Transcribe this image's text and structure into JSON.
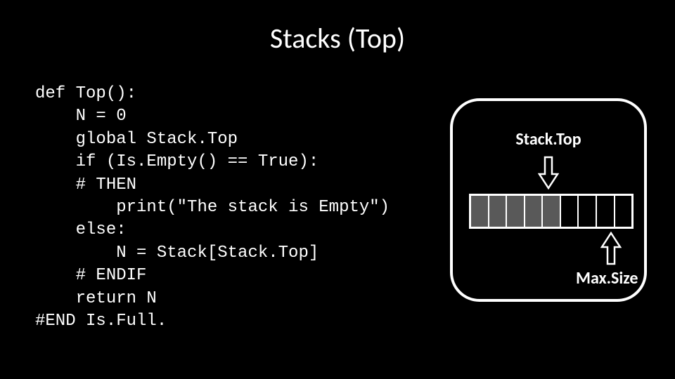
{
  "slide": {
    "title": "Stacks (Top)"
  },
  "code": {
    "line1": "def Top():",
    "line2": "    N = 0",
    "line3": "    global Stack.Top",
    "line4": "    if (Is.Empty() == True):",
    "line5": "    # THEN",
    "line6": "        print(\"The stack is Empty\")",
    "line7": "    else:",
    "line8": "        N = Stack[Stack.Top]",
    "line9": "    # ENDIF",
    "line10": "    return N",
    "line11": "#END Is.Full."
  },
  "diagram": {
    "stack_top_label": "Stack.Top",
    "max_size_label": "Max.Size",
    "total_cells": 9,
    "filled_cells": 5
  }
}
